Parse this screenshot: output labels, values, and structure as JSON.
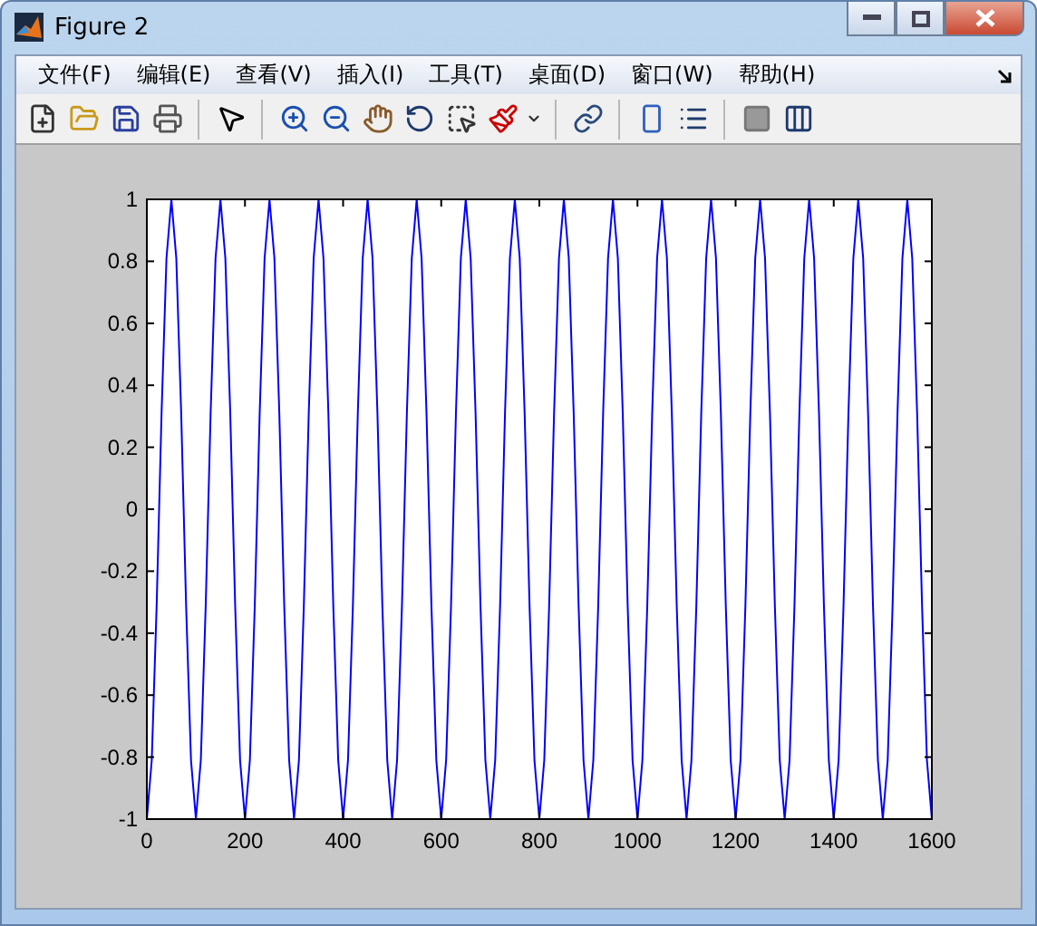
{
  "window": {
    "title": "Figure 2"
  },
  "menu": [
    "文件(F)",
    "编辑(E)",
    "查看(V)",
    "插入(I)",
    "工具(T)",
    "桌面(D)",
    "窗口(W)",
    "帮助(H)"
  ],
  "toolbar": [
    {
      "kind": "new"
    },
    {
      "kind": "open"
    },
    {
      "kind": "save"
    },
    {
      "kind": "print"
    },
    {
      "kind": "sep"
    },
    {
      "kind": "pointer"
    },
    {
      "kind": "sep"
    },
    {
      "kind": "zoom-in"
    },
    {
      "kind": "zoom-out"
    },
    {
      "kind": "pan"
    },
    {
      "kind": "rotate"
    },
    {
      "kind": "data-cursor"
    },
    {
      "kind": "brush"
    },
    {
      "kind": "dropdown"
    },
    {
      "kind": "sep"
    },
    {
      "kind": "link"
    },
    {
      "kind": "sep"
    },
    {
      "kind": "colorbar"
    },
    {
      "kind": "legend"
    },
    {
      "kind": "sep"
    },
    {
      "kind": "hide-tools"
    },
    {
      "kind": "show-tools"
    }
  ],
  "chart_data": {
    "type": "line",
    "xlim": [
      0,
      1600
    ],
    "ylim": [
      -1,
      1
    ],
    "xticks": [
      0,
      200,
      400,
      600,
      800,
      1000,
      1200,
      1400,
      1600
    ],
    "yticks": [
      {
        "value": -1,
        "label": "-1"
      },
      {
        "value": -0.8,
        "label": "-0.8"
      },
      {
        "value": -0.6,
        "label": "-0.6"
      },
      {
        "value": -0.4,
        "label": "-0.4"
      },
      {
        "value": -0.2,
        "label": "-0.2"
      },
      {
        "value": 0,
        "label": "0"
      },
      {
        "value": 0.2,
        "label": "0.2"
      },
      {
        "value": 0.4,
        "label": "0.4"
      },
      {
        "value": 0.6,
        "label": "0.6"
      },
      {
        "value": 0.8,
        "label": "0.8"
      },
      {
        "value": 1,
        "label": "1"
      }
    ],
    "x": [
      0,
      10,
      20,
      30,
      40,
      50,
      60,
      70,
      80,
      90,
      100,
      110,
      120,
      130,
      140,
      150,
      160,
      170,
      180,
      190,
      200,
      210,
      220,
      230,
      240,
      250,
      260,
      270,
      280,
      290,
      300,
      310,
      320,
      330,
      340,
      350,
      360,
      370,
      380,
      390,
      400,
      410,
      420,
      430,
      440,
      450,
      460,
      470,
      480,
      490,
      500,
      510,
      520,
      530,
      540,
      550,
      560,
      570,
      580,
      590,
      600,
      610,
      620,
      630,
      640,
      650,
      660,
      670,
      680,
      690,
      700,
      710,
      720,
      730,
      740,
      750,
      760,
      770,
      780,
      790,
      800,
      810,
      820,
      830,
      840,
      850,
      860,
      870,
      880,
      890,
      900,
      910,
      920,
      930,
      940,
      950,
      960,
      970,
      980,
      990,
      1000,
      1010,
      1020,
      1030,
      1040,
      1050,
      1060,
      1070,
      1080,
      1090,
      1100,
      1110,
      1120,
      1130,
      1140,
      1150,
      1160,
      1170,
      1180,
      1190,
      1200,
      1210,
      1220,
      1230,
      1240,
      1250,
      1260,
      1270,
      1280,
      1290,
      1300,
      1310,
      1320,
      1330,
      1340,
      1350,
      1360,
      1370,
      1380,
      1390,
      1400,
      1410,
      1420,
      1430,
      1440,
      1450,
      1460,
      1470,
      1480,
      1490,
      1500,
      1510,
      1520,
      1530,
      1540,
      1550,
      1560,
      1570,
      1580,
      1590,
      1600
    ],
    "series": [
      {
        "color": "#0000ff",
        "values": [
          -1,
          -0.81,
          -0.31,
          0.31,
          0.81,
          1,
          0.81,
          0.31,
          -0.31,
          -0.81,
          -1,
          -0.81,
          -0.31,
          0.31,
          0.81,
          1,
          0.81,
          0.31,
          -0.31,
          -0.81,
          -1,
          -0.81,
          -0.31,
          0.31,
          0.81,
          1,
          0.81,
          0.31,
          -0.31,
          -0.81,
          -1,
          -0.81,
          -0.31,
          0.31,
          0.81,
          1,
          0.81,
          0.31,
          -0.31,
          -0.81,
          -1,
          -0.81,
          -0.31,
          0.31,
          0.81,
          1,
          0.81,
          0.31,
          -0.31,
          -0.81,
          -1,
          -0.81,
          -0.31,
          0.31,
          0.81,
          1,
          0.81,
          0.31,
          -0.31,
          -0.81,
          -1,
          -0.81,
          -0.31,
          0.31,
          0.81,
          1,
          0.81,
          0.31,
          -0.31,
          -0.81,
          -1,
          -0.81,
          -0.31,
          0.31,
          0.81,
          1,
          0.81,
          0.31,
          -0.31,
          -0.81,
          -1,
          -0.81,
          -0.31,
          0.31,
          0.81,
          1,
          0.81,
          0.31,
          -0.31,
          -0.81,
          -1,
          -0.81,
          -0.31,
          0.31,
          0.81,
          1,
          0.81,
          0.31,
          -0.31,
          -0.81,
          -1,
          -0.81,
          -0.31,
          0.31,
          0.81,
          1,
          0.81,
          0.31,
          -0.31,
          -0.81,
          -1,
          -0.81,
          -0.31,
          0.31,
          0.81,
          1,
          0.81,
          0.31,
          -0.31,
          -0.81,
          -1,
          -0.81,
          -0.31,
          0.31,
          0.81,
          1,
          0.81,
          0.31,
          -0.31,
          -0.81,
          -1,
          -0.81,
          -0.31,
          0.31,
          0.81,
          1,
          0.81,
          0.31,
          -0.31,
          -0.81,
          -1,
          -0.81,
          -0.31,
          0.31,
          0.81,
          1,
          0.81,
          0.31,
          -0.31,
          -0.81,
          -1,
          -0.81,
          -0.31,
          0.31,
          0.81,
          1,
          0.81,
          0.31,
          -0.31,
          -0.81,
          -1
        ]
      }
    ]
  }
}
